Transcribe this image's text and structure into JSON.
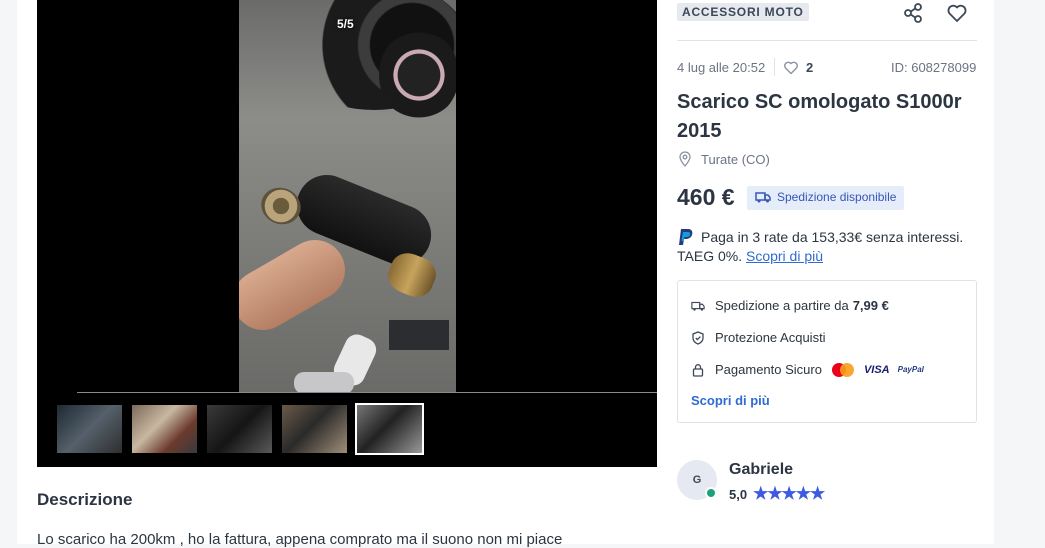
{
  "gallery": {
    "counter": "5/5",
    "thumbnails": [
      "photo-1",
      "photo-2",
      "photo-3",
      "photo-4",
      "photo-5"
    ],
    "selected_index": 5
  },
  "description": {
    "title": "Descrizione",
    "text": "Lo scarico ha 200km , ho la fattura, appena comprato ma il suono non mi piace"
  },
  "listing": {
    "category": "ACCESSORI MOTO",
    "date": "4 lug alle 20:52",
    "favorites": "2",
    "id": "ID: 608278099",
    "title": "Scarico SC omologato S1000r 2015",
    "location": "Turate (CO)",
    "price": "460 €",
    "shipping_badge": "Spedizione disponibile"
  },
  "payment": {
    "line1": "Paga in 3 rate da 153,33€ senza interessi.",
    "line2": "TAEG 0%.",
    "link": "Scopri di più"
  },
  "info_box": {
    "shipping_label": "Spedizione a partire da",
    "shipping_price": "7,99 €",
    "protection": "Protezione Acquisti",
    "secure_payment": "Pagamento Sicuro",
    "visa": "VISA",
    "paypal": "PayPal",
    "link": "Scopri di più"
  },
  "seller": {
    "initial": "G",
    "name": "Gabriele",
    "rating": "5,0",
    "stars": "★★★★★"
  },
  "colors": {
    "accent": "#3d5ae0",
    "link": "#2f6bd2",
    "online": "#1aa37a"
  }
}
